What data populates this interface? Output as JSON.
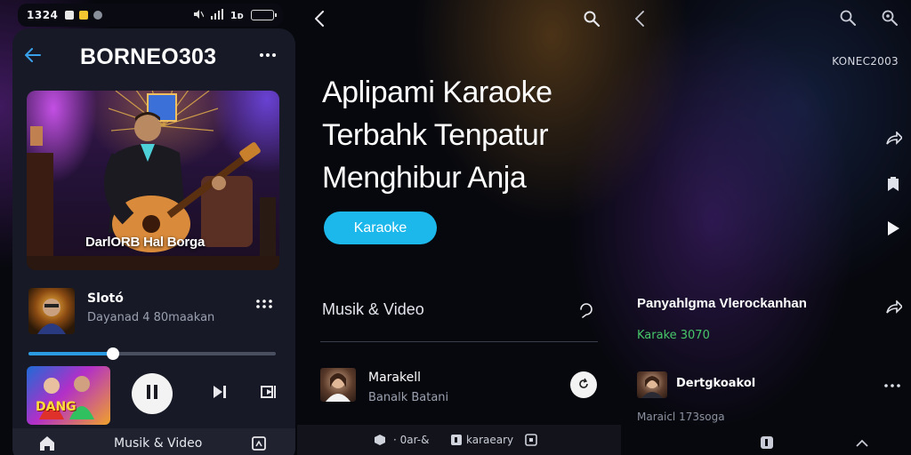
{
  "colors": {
    "accent_blue": "#1cb8ec",
    "progress_blue": "#2c9ae0",
    "status_green": "#47c76a",
    "panel_bg": "#171a26",
    "page_bg": "#07080e"
  },
  "status_bar": {
    "time": "1324",
    "right_text": "1ᴅ",
    "battery_level": 0.8
  },
  "panel1": {
    "title": "BORNEO303",
    "hero_caption": "DarlORB Hal Borga",
    "now_playing": {
      "title": "Slotó",
      "subtitle": "Dayanad 4 80maakan"
    },
    "progress": 0.34,
    "mini_art_text": "DANG",
    "nav": {
      "label": "Musik & Video"
    }
  },
  "panel2": {
    "headline_lines": [
      "Aplipami Karaoke",
      "Terbahk Tenpatur",
      "Menghibur Anja"
    ],
    "karaoke_button": "Karaoke",
    "section_title": "Musik & Video",
    "item": {
      "title": "Marakell",
      "subtitle": "Banalk Batani"
    },
    "bottom_bar": {
      "item1": "· 0ar-&",
      "item2": "karaeary"
    }
  },
  "panel3": {
    "brand": "KONEC2003",
    "song_title": "Panyahlgma Vlerockanhan",
    "song_subtitle": "Karake 3070",
    "item": {
      "title": "Dertgkoakol",
      "subtitle": "Maraicl 173soga"
    }
  }
}
